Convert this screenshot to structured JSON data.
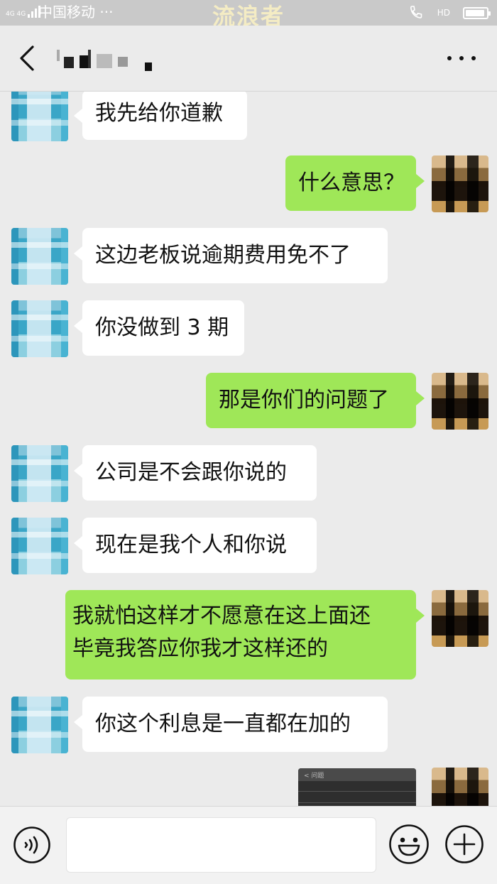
{
  "status_bar": {
    "network": "4G 4G",
    "carrier": "中国移动 ···",
    "watermark": "流浪者",
    "hd": "HD"
  },
  "header": {
    "contact_name": ""
  },
  "messages": [
    {
      "side": "left",
      "text": "我先给你道歉"
    },
    {
      "side": "right",
      "text": "什么意思？"
    },
    {
      "side": "left",
      "text": "这边老板说逾期费用免不了"
    },
    {
      "side": "left",
      "text": "你没做到 3 期"
    },
    {
      "side": "right",
      "text": "那是你们的问题了"
    },
    {
      "side": "left",
      "text": "公司是不会跟你说的"
    },
    {
      "side": "left",
      "text": "现在是我个人和你说"
    },
    {
      "side": "right",
      "text": "我就怕这样才不愿意在这上面还\n毕竟我答应你我才这样还的"
    },
    {
      "side": "left",
      "text": "你这个利息是一直都在加的"
    }
  ],
  "image_message": {
    "label": "< 问题"
  },
  "input": {
    "value": "",
    "placeholder": ""
  },
  "colors": {
    "background": "#ebebeb",
    "self_bubble": "#9fe758",
    "other_bubble": "#ffffff",
    "status_bar": "#c9c9c9"
  },
  "icons": [
    "back-icon",
    "more-icon",
    "voice-icon",
    "emoji-icon",
    "plus-icon"
  ]
}
